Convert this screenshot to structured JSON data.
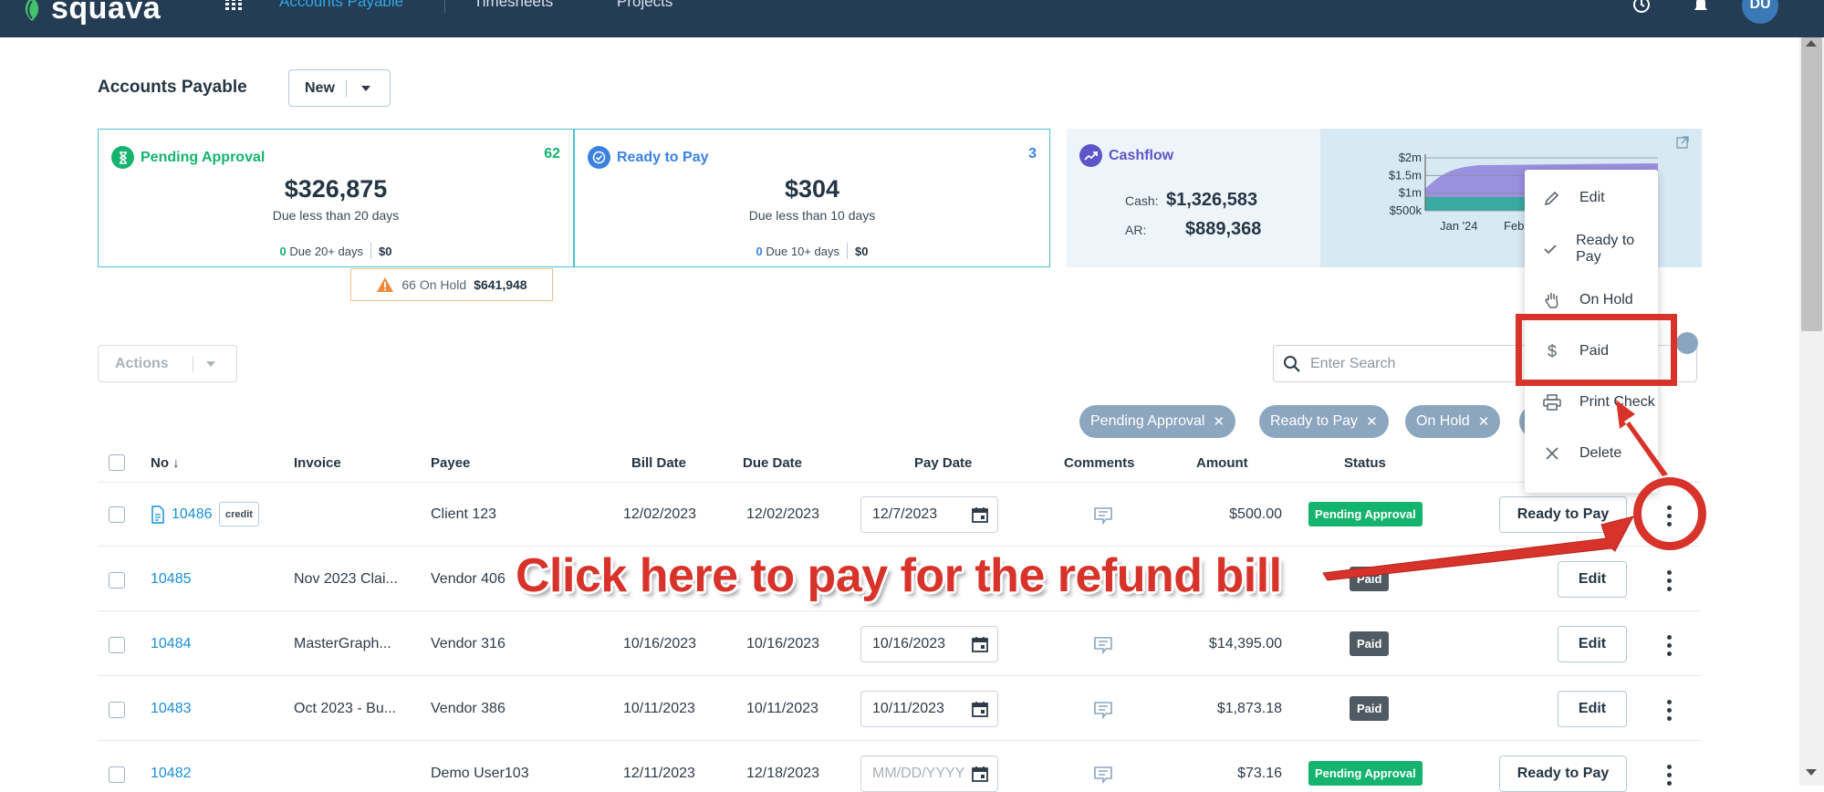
{
  "app": {
    "logo_text": "squava",
    "nav": [
      "Accounts Payable",
      "Timesheets",
      "Projects"
    ],
    "avatar_initials": "DU"
  },
  "page": {
    "title": "Accounts Payable",
    "new_button": "New"
  },
  "cards": {
    "pending": {
      "title": "Pending Approval",
      "count": "62",
      "amount": "$326,875",
      "sub": "Due less than 20 days",
      "foot_count": "0",
      "foot_label": "Due 20+ days",
      "foot_amount": "$0",
      "color": "#14b36e"
    },
    "ready": {
      "title": "Ready to Pay",
      "count": "3",
      "amount": "$304",
      "sub": "Due less than 10 days",
      "foot_count": "0",
      "foot_label": "Due 10+ days",
      "foot_amount": "$0",
      "color": "#3b82e0"
    },
    "onhold": {
      "label": "66 On Hold",
      "amount": "$641,948",
      "color": "#f08a3a"
    },
    "cashflow": {
      "title": "Cashflow",
      "cash_label": "Cash:",
      "cash_value": "$1,326,583",
      "ar_label": "AR:",
      "ar_value": "$889,368"
    }
  },
  "chart_data": {
    "type": "area",
    "title": "",
    "y_tick_labels": [
      "$2m",
      "$1.5m",
      "$1m",
      "$500k"
    ],
    "x_tick_labels": [
      "Jan '24",
      "Feb '24"
    ],
    "series": [
      {
        "color": "#9b8fe0"
      },
      {
        "color": "#3aa9a0"
      }
    ]
  },
  "toolbar": {
    "actions_label": "Actions",
    "search_placeholder": "Enter Search"
  },
  "filters": [
    "Pending Approval",
    "Ready to Pay",
    "On Hold"
  ],
  "table": {
    "headers": {
      "no": "No",
      "invoice": "Invoice",
      "payee": "Payee",
      "bill_date": "Bill Date",
      "due_date": "Due Date",
      "pay_date": "Pay Date",
      "comments": "Comments",
      "amount": "Amount",
      "status": "Status"
    },
    "rows": [
      {
        "no": "10486",
        "credit": "credit",
        "invoice": "",
        "payee": "Client 123",
        "bill_date": "12/02/2023",
        "due_date": "12/02/2023",
        "pay_date": "12/7/2023",
        "amount": "$500.00",
        "status": "Pending Approval",
        "action": "Ready to Pay"
      },
      {
        "no": "10485",
        "invoice": "Nov 2023 Clai...",
        "payee": "Vendor 406",
        "bill_date": "",
        "due_date": "",
        "pay_date": "",
        "amount": "",
        "status": "Paid",
        "action": "Edit"
      },
      {
        "no": "10484",
        "invoice": "MasterGraph...",
        "payee": "Vendor 316",
        "bill_date": "10/16/2023",
        "due_date": "10/16/2023",
        "pay_date": "10/16/2023",
        "amount": "$14,395.00",
        "status": "Paid",
        "action": "Edit"
      },
      {
        "no": "10483",
        "invoice": "Oct 2023 - Bu...",
        "payee": "Vendor 386",
        "bill_date": "10/11/2023",
        "due_date": "10/11/2023",
        "pay_date": "10/11/2023",
        "amount": "$1,873.18",
        "status": "Paid",
        "action": "Edit"
      },
      {
        "no": "10482",
        "invoice": "",
        "payee": "Demo User103",
        "bill_date": "12/11/2023",
        "due_date": "12/18/2023",
        "pay_date_placeholder": "MM/DD/YYYY",
        "amount": "$73.16",
        "status": "Pending Approval",
        "action": "Ready to Pay"
      }
    ]
  },
  "row_menu": {
    "items": [
      {
        "label": "Edit",
        "icon": "pencil-icon"
      },
      {
        "label": "Ready to Pay",
        "icon": "check-icon"
      },
      {
        "label": "On Hold",
        "icon": "hand-icon"
      },
      {
        "label": "Paid",
        "icon": "dollar-icon"
      },
      {
        "label": "Print Check",
        "icon": "printer-icon"
      },
      {
        "label": "Delete",
        "icon": "close-icon"
      }
    ]
  },
  "annotation": {
    "text": "Click here to pay for the refund bill",
    "color": "#d8332a"
  }
}
